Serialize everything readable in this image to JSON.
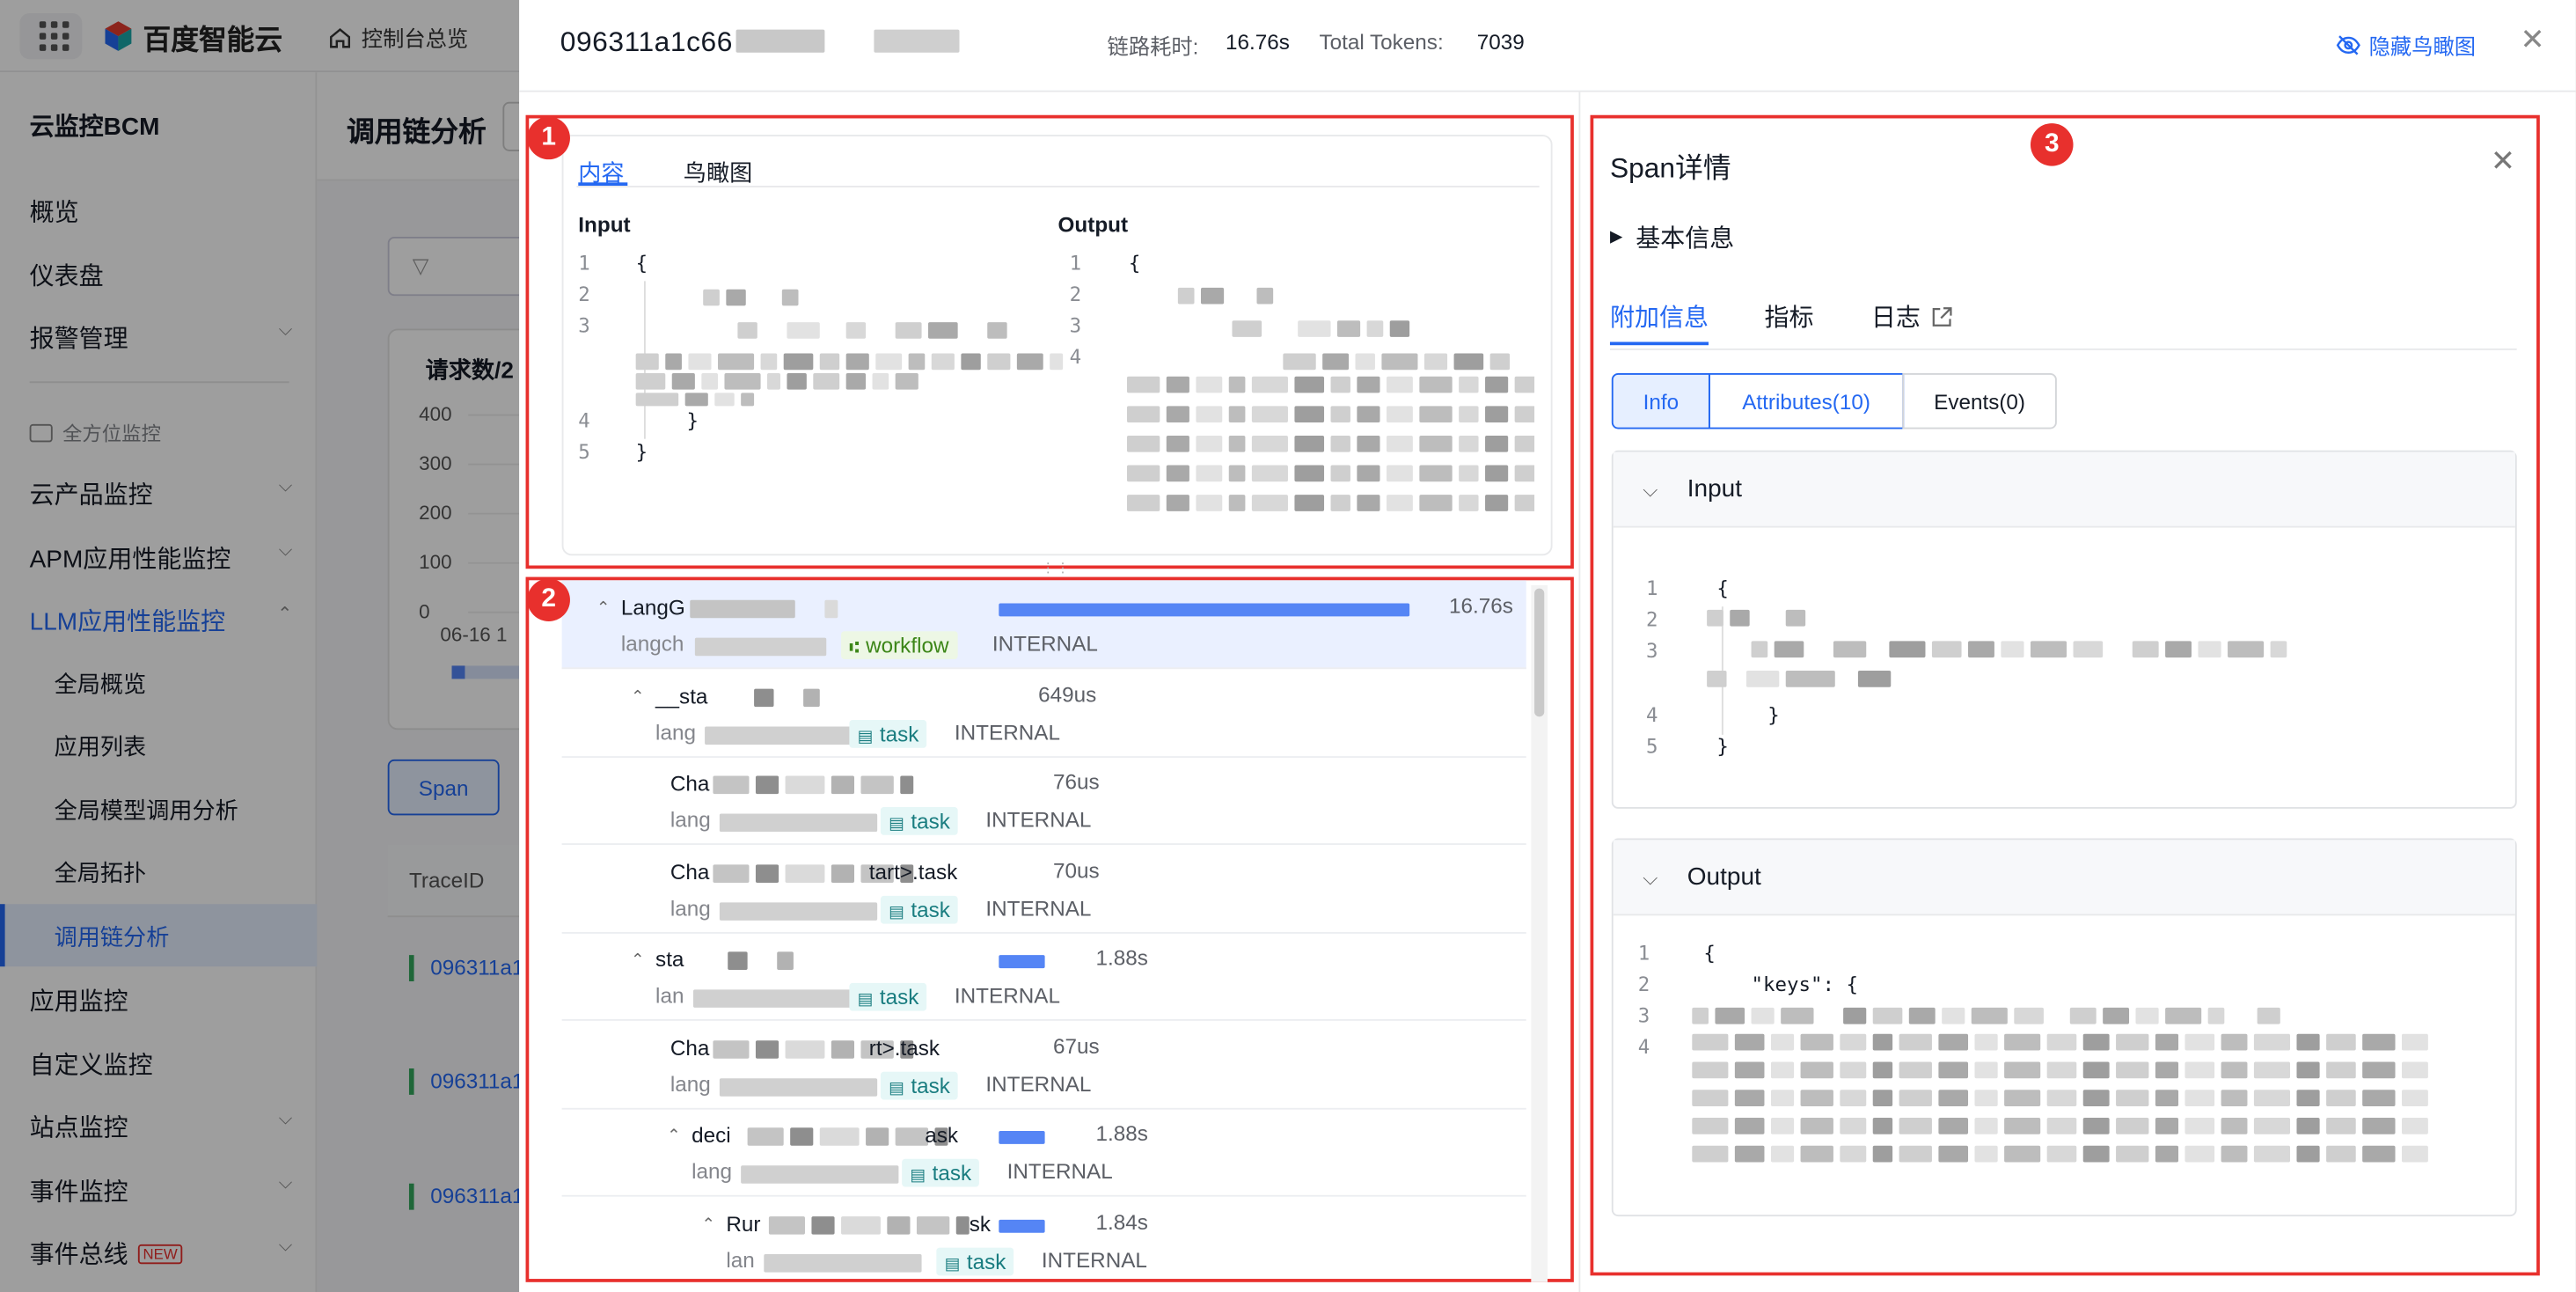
{
  "topbar": {
    "brand": "百度智能云",
    "console": "控制台总览"
  },
  "sidebar": {
    "title": "云监控BCM",
    "items": [
      {
        "label": "概览",
        "chev": false
      },
      {
        "label": "仪表盘",
        "chev": false
      },
      {
        "label": "报警管理",
        "chev": true
      }
    ],
    "section": "全方位监控",
    "items2": [
      {
        "label": "云产品监控",
        "chev": true
      },
      {
        "label": "APM应用性能监控",
        "chev": true
      },
      {
        "label": "LLM应用性能监控",
        "chev": true,
        "open": true
      }
    ],
    "subitems": [
      "全局概览",
      "应用列表",
      "全局模型调用分析",
      "全局拓扑",
      "调用链分析"
    ],
    "items3": [
      {
        "label": "应用监控",
        "chev": false
      },
      {
        "label": "自定义监控",
        "chev": false
      },
      {
        "label": "站点监控",
        "chev": true
      },
      {
        "label": "事件监控",
        "chev": true
      },
      {
        "label": "事件总线",
        "chev": true,
        "badge": "NEW"
      }
    ]
  },
  "main": {
    "page_title": "调用链分析",
    "chart_title": "请求数/2",
    "yticks": [
      "400",
      "300",
      "200",
      "100",
      "0"
    ],
    "xtick": "06-16 1",
    "span_btn": "Span",
    "table_header": "TraceID",
    "trace_rows": [
      "096311a1",
      "096311a1",
      "096311a1"
    ]
  },
  "drawer": {
    "trace_id": "096311a1c66",
    "latency_label": "链路耗时:",
    "latency_value": "16.76s",
    "tokens_label": "Total Tokens:",
    "tokens_value": "7039",
    "hide_birdview": "隐藏鸟瞰图"
  },
  "badges": [
    "1",
    "2",
    "3"
  ],
  "panel1": {
    "tabs": [
      "内容",
      "鸟瞰图"
    ],
    "input_label": "Input",
    "output_label": "Output",
    "input_lines": [
      "1",
      "2",
      "3",
      "4",
      "5"
    ],
    "output_lines": [
      "1",
      "2",
      "3",
      "4"
    ],
    "open_brace": "{",
    "close_brace": "}"
  },
  "tree": [
    {
      "name": "LangG",
      "sub": "langch",
      "tag": "workflow",
      "kind": "INTERNAL",
      "dur": "16.76s",
      "bar": 1.0,
      "level": 0,
      "caret": true,
      "selected": true
    },
    {
      "name": "__sta",
      "sub": "lang",
      "tag": "task",
      "kind": "INTERNAL",
      "dur": "649us",
      "bar": 0,
      "level": 1,
      "caret": true
    },
    {
      "name": "Cha",
      "sub": "lang",
      "tag": "task",
      "kind": "INTERNAL",
      "dur": "76us",
      "bar": 0,
      "level": 2,
      "caret": false
    },
    {
      "name": "Cha",
      "suffix": "tart>.task",
      "sub": "lang",
      "tag": "task",
      "kind": "INTERNAL",
      "dur": "70us",
      "bar": 0,
      "level": 2,
      "caret": false
    },
    {
      "name": "sta",
      "sub": "lan",
      "tag": "task",
      "kind": "INTERNAL",
      "dur": "1.88s",
      "bar": 0.112,
      "level": 1,
      "caret": true
    },
    {
      "name": "Cha",
      "suffix": "rt>.task",
      "sub": "lang",
      "tag": "task",
      "kind": "INTERNAL",
      "dur": "67us",
      "bar": 0,
      "level": 2,
      "caret": false
    },
    {
      "name": "deci",
      "suffix": "ask",
      "sub": "lang",
      "tag": "task",
      "kind": "INTERNAL",
      "dur": "1.88s",
      "bar": 0.112,
      "level": 2,
      "caret": true
    },
    {
      "name": "Rur",
      "suffix": "sk",
      "sub": "lan",
      "tag": "task",
      "kind": "INTERNAL",
      "dur": "1.84s",
      "bar": 0.11,
      "level": 3,
      "caret": true
    }
  ],
  "panel3": {
    "title": "Span详情",
    "basic": "基本信息",
    "tabs": [
      "附加信息",
      "指标",
      "日志"
    ],
    "segs": [
      "Info",
      "Attributes(10)",
      "Events(0)"
    ],
    "input_title": "Input",
    "output_title": "Output",
    "input_lines": [
      "1",
      "2",
      "3",
      "4",
      "5"
    ],
    "output_lines": [
      "1",
      "2",
      "3",
      "4"
    ],
    "open_brace": "{",
    "close_brace": "}",
    "keys_text": "\"keys\": {"
  },
  "colors": {
    "accent": "#2468f2",
    "danger": "#e8302d",
    "bar": "#5585f5"
  }
}
